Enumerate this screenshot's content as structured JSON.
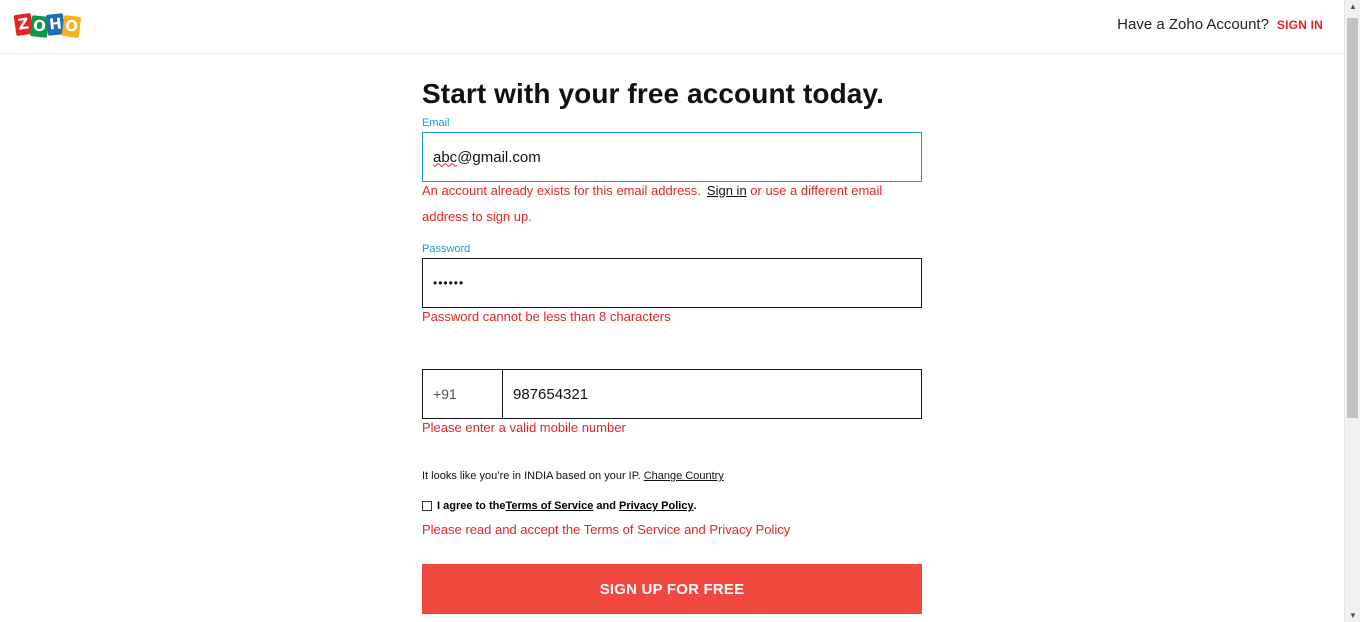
{
  "header": {
    "logo_letters": [
      "Z",
      "O",
      "H",
      "O"
    ],
    "logo_colors": [
      "#e42527",
      "#089949",
      "#226db4",
      "#f9b21d"
    ],
    "have_account_text": "Have a Zoho Account?",
    "signin_label": "SIGN IN"
  },
  "form": {
    "title": "Start with your free account today.",
    "email": {
      "label": "Email",
      "value_misspelled": "abc",
      "value_rest": "@gmail.com",
      "error_prefix": "An account already exists for this email address.",
      "error_link": "Sign in",
      "error_suffix": " or use a different email",
      "error_line2": "address to sign up."
    },
    "password": {
      "label": "Password",
      "value_masked": "••••••",
      "error": "Password cannot be less than 8 characters"
    },
    "phone": {
      "country_code": "+91",
      "value": "987654321",
      "error": "Please enter a valid mobile number"
    },
    "ip_note": {
      "prefix": "It looks like you’re in ",
      "country": "INDIA",
      "suffix": " based on your IP.",
      "change_link": "Change Country"
    },
    "agree": {
      "prefix": "I agree to the ",
      "terms_link": "Terms of Service",
      "and": " and ",
      "privacy_link": "Privacy Policy",
      "suffix": ".",
      "checked": false,
      "error": "Please read and accept the Terms of Service and Privacy Policy"
    },
    "submit_label": "SIGN UP FOR FREE"
  },
  "colors": {
    "accent_blue": "#1a9bd6",
    "error_red": "#e42527",
    "button_red": "#f0483e"
  }
}
